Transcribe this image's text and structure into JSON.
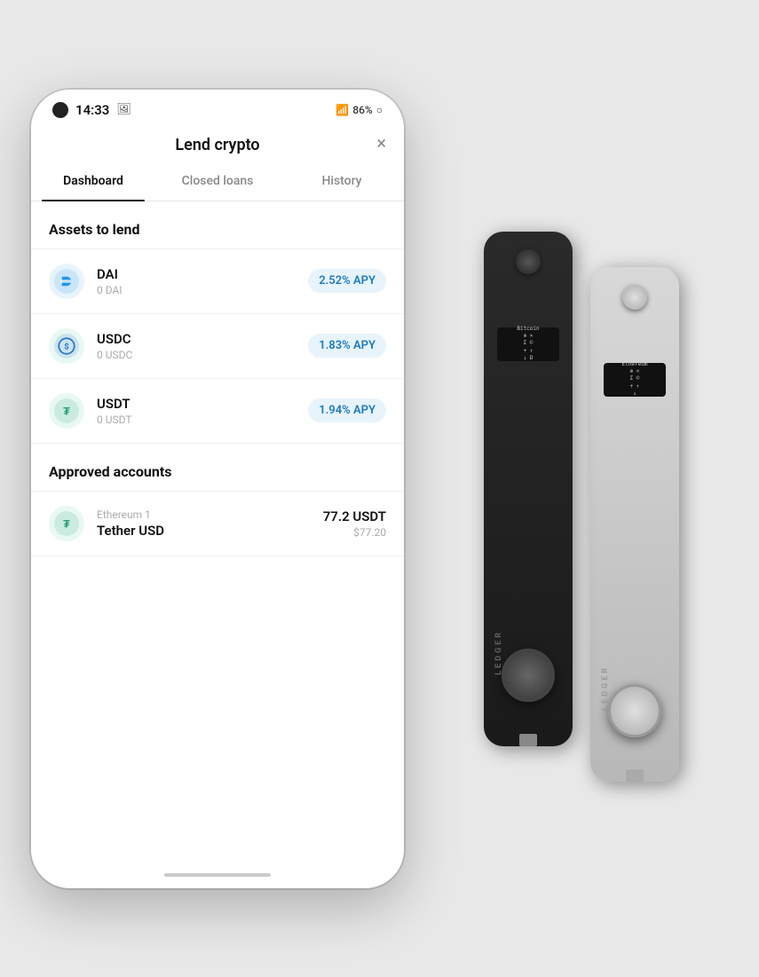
{
  "status_bar": {
    "time": "14:33",
    "battery": "86%",
    "signal": "4G"
  },
  "app": {
    "title": "Lend crypto",
    "close_label": "×"
  },
  "tabs": [
    {
      "id": "dashboard",
      "label": "Dashboard",
      "active": true
    },
    {
      "id": "closed_loans",
      "label": "Closed loans",
      "active": false
    },
    {
      "id": "history",
      "label": "History",
      "active": false
    }
  ],
  "assets_section": {
    "title": "Assets to lend",
    "items": [
      {
        "symbol": "DAI",
        "balance": "0 DAI",
        "apy": "2.52% APY",
        "type": "dai"
      },
      {
        "symbol": "USDC",
        "balance": "0 USDC",
        "apy": "1.83% APY",
        "type": "usdc"
      },
      {
        "symbol": "USDT",
        "balance": "0 USDT",
        "apy": "1.94% APY",
        "type": "usdt"
      }
    ]
  },
  "approved_section": {
    "title": "Approved accounts",
    "items": [
      {
        "account": "Ethereum 1",
        "name": "Tether USD",
        "amount": "77.2 USDT",
        "usd": "$77.20",
        "type": "usdt"
      }
    ]
  },
  "ledger_devices": [
    {
      "label": "LEDGER",
      "model": "Nano X",
      "color": "black"
    },
    {
      "label": "LEDGER",
      "model": "Nano X",
      "color": "silver"
    }
  ]
}
